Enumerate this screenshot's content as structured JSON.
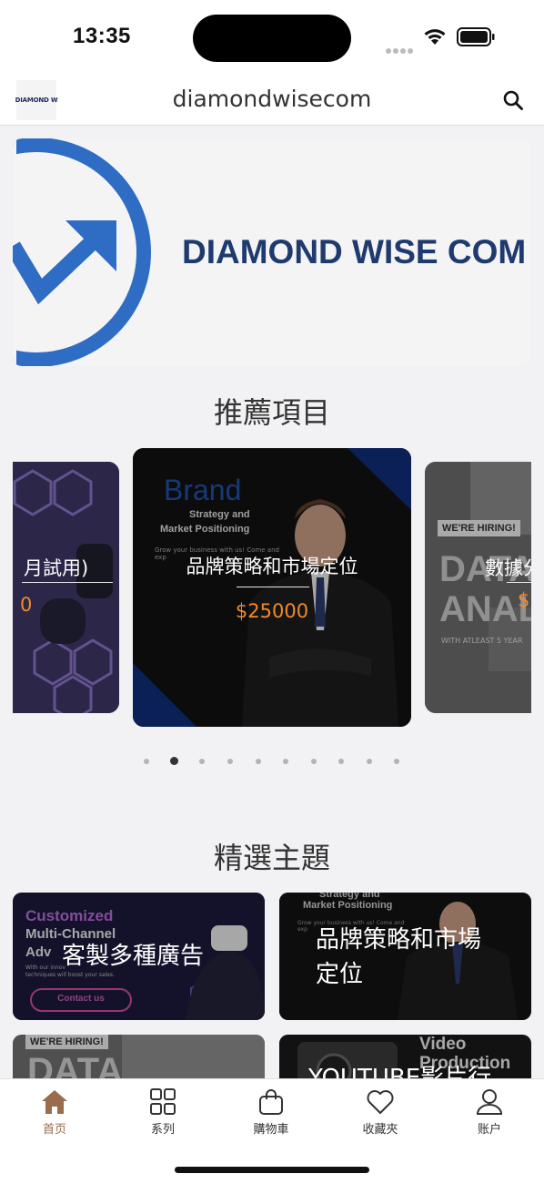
{
  "status_bar": {
    "time": "13:35"
  },
  "header": {
    "logo_text": "DIAMOND W",
    "title": "diamondwisecom"
  },
  "banner": {
    "text": "DIAMOND WISE COM"
  },
  "recommended": {
    "title": "推薦項目",
    "cards": [
      {
        "label": "月試用)",
        "price": "0"
      },
      {
        "label": "品牌策略和市場定位",
        "price": "$25000",
        "image_heading": "Brand",
        "image_sub1": "Strategy and",
        "image_sub2": "Market Positioning",
        "image_small": "Grow your business with us! Come and exp"
      },
      {
        "label": "數據分",
        "price": "$",
        "image_tag": "WE'RE HIRING!",
        "image_word1": "DATA",
        "image_word2": "ANAL",
        "image_small": "WITH ATLEAST 5 YEAR"
      }
    ],
    "active_index": 1,
    "dot_count": 10
  },
  "featured": {
    "title": "精選主題",
    "tiles": [
      {
        "label": "客製多種廣告",
        "img_line1": "Customized",
        "img_line2": "Multi-Channel",
        "img_line3": "Adv",
        "img_button": "Contact us",
        "img_small": "With our innov",
        "img_small2": "techniques will boost your sales."
      },
      {
        "label_line1": "品牌策略和市場",
        "label_line2": "定位",
        "img_line1": "Strategy and",
        "img_line2": "Market Positioning",
        "img_small": "Grow your business with us! Come and exp"
      },
      {
        "label": "",
        "img_tag": "WE'RE HIRING!",
        "img_word": "DATA"
      },
      {
        "label": "YOUTUBE影片行",
        "img_line1": "Video",
        "img_line2": "Production"
      }
    ]
  },
  "tabbar": {
    "items": [
      {
        "label": "首页",
        "icon": "home-icon"
      },
      {
        "label": "系列",
        "icon": "grid-icon"
      },
      {
        "label": "購物車",
        "icon": "shopping-bag-icon"
      },
      {
        "label": "收藏夾",
        "icon": "heart-icon"
      },
      {
        "label": "账户",
        "icon": "user-icon"
      }
    ],
    "active_color": "#9a6b4d"
  },
  "colors": {
    "accent_price": "#f08a2a",
    "brand_blue": "#2f6cc4",
    "brand_navy": "#1e3a6e"
  }
}
